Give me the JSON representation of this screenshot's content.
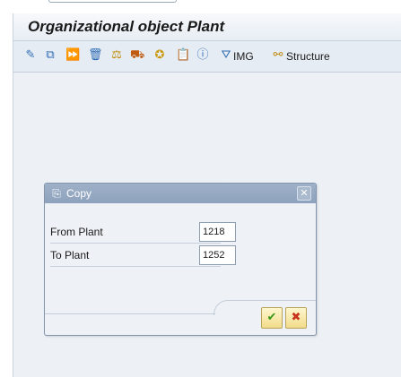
{
  "window": {
    "title": "Organizational object Plant"
  },
  "toolbar": {
    "icons": [
      "display-change-icon",
      "copy-icon",
      "copy-as-icon",
      "delete-icon",
      "assign-icon",
      "transport-icon",
      "check-icon",
      "clipboard-icon",
      "info-icon"
    ],
    "img_label": "IMG",
    "structure_label": "Structure"
  },
  "dialog": {
    "title": "Copy",
    "fields": [
      {
        "label": "From Plant",
        "value": "1218"
      },
      {
        "label": "To Plant",
        "value": "1252"
      }
    ],
    "confirm_icon": "checkmark-icon",
    "cancel_icon": "cancel-x-icon",
    "colors": {
      "header": "#8ea2bd",
      "confirm": "#3a9a1a",
      "cancel": "#c8321e"
    }
  }
}
